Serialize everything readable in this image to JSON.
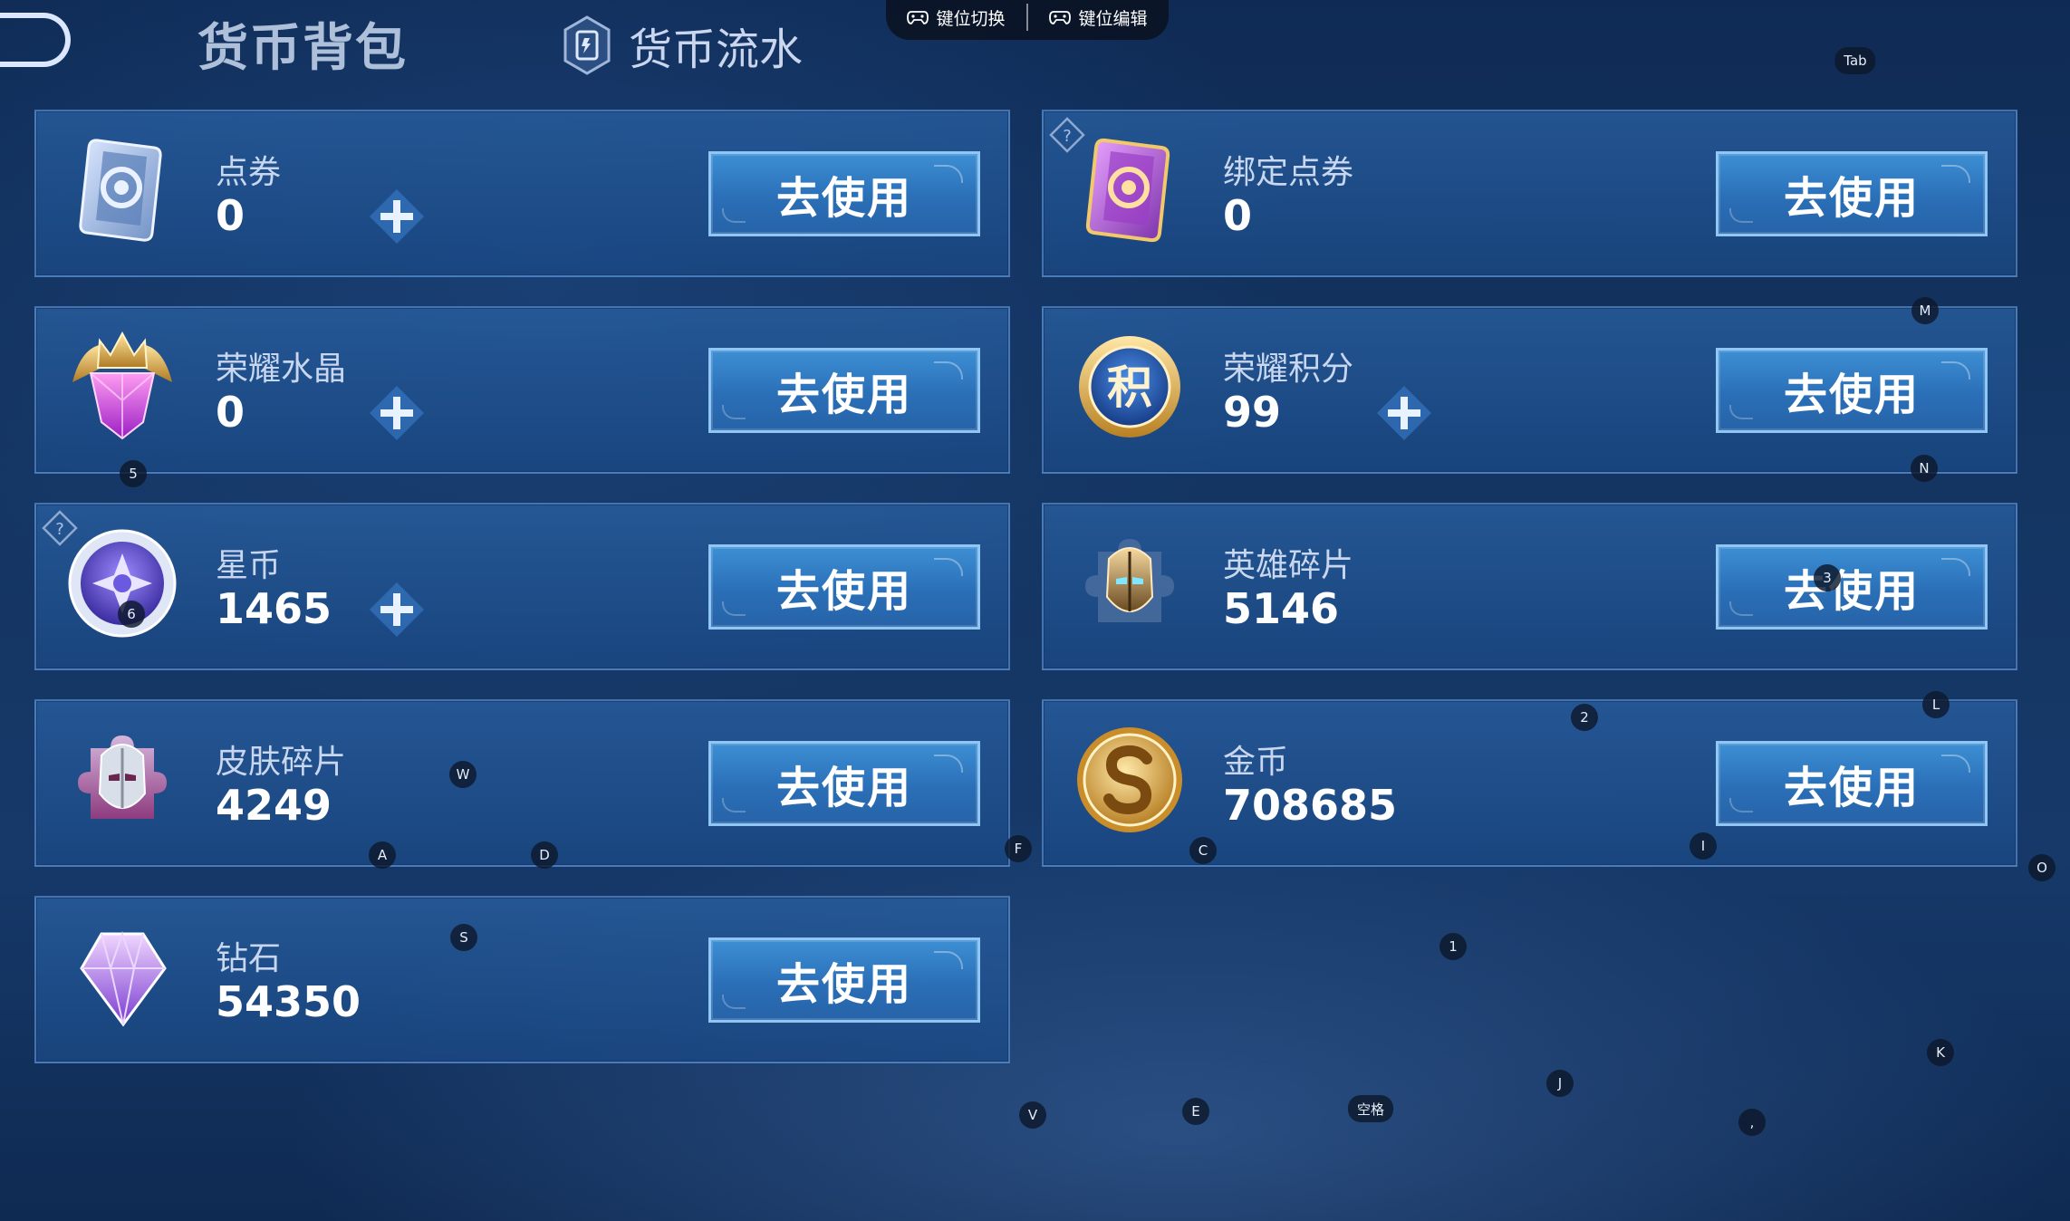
{
  "header": {
    "tab_active": "货币背包",
    "tab_flow": "货币流水",
    "keymap_switch": "键位切换",
    "keymap_edit": "键位编辑"
  },
  "cards": [
    {
      "name": "点券",
      "amount": "0",
      "button": "去使用",
      "icon": "voucher-card-icon"
    },
    {
      "name": "绑定点券",
      "amount": "0",
      "button": "去使用",
      "icon": "bound-voucher-card-icon"
    },
    {
      "name": "荣耀水晶",
      "amount": "0",
      "button": "去使用",
      "icon": "glory-crystal-icon"
    },
    {
      "name": "荣耀积分",
      "amount": "99",
      "button": "去使用",
      "icon": "glory-points-icon"
    },
    {
      "name": "星币",
      "amount": "1465",
      "button": "去使用",
      "icon": "star-coin-icon"
    },
    {
      "name": "英雄碎片",
      "amount": "5146",
      "button": "去使用",
      "icon": "hero-fragment-icon"
    },
    {
      "name": "皮肤碎片",
      "amount": "4249",
      "button": "去使用",
      "icon": "skin-fragment-icon"
    },
    {
      "name": "金币",
      "amount": "708685",
      "button": "去使用",
      "icon": "gold-coin-icon"
    },
    {
      "name": "钻石",
      "amount": "54350",
      "button": "去使用",
      "icon": "diamond-icon"
    }
  ],
  "points_badge_glyph": "积",
  "key_hints": [
    "Tab",
    "M",
    "5",
    "N",
    "6",
    "3",
    "2",
    "L",
    "W",
    "A",
    "D",
    "F",
    "C",
    "I",
    "O",
    "S",
    "1",
    "K",
    "J",
    "V",
    "E",
    "空格",
    ","
  ],
  "colors": {
    "card_bg": "#245c9c",
    "button_bg": "#2f7cc3",
    "button_border": "#8fc6f4",
    "plus": "#4ea3e8"
  }
}
